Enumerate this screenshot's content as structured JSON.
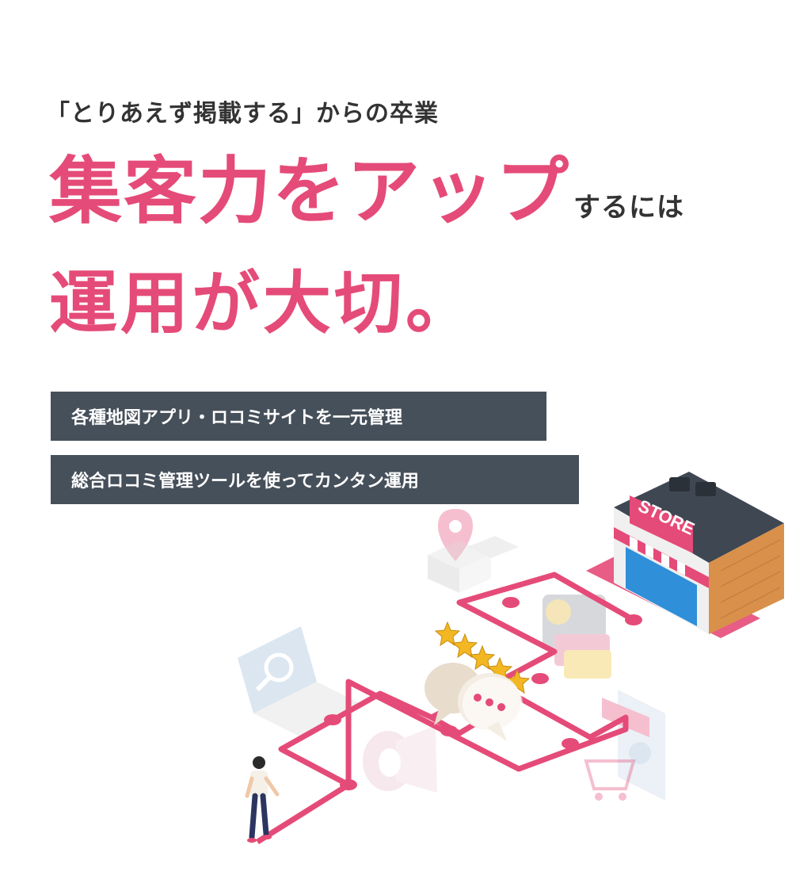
{
  "subtitle": "「とりあえず掲載する」からの卒業",
  "headline": {
    "line1_main": "集客力をアップ",
    "line1_suffix": "するには",
    "line2": "運用が大切。"
  },
  "features": [
    "各種地図アプリ・ロコミサイトを一元管理",
    "総合ロコミ管理ツールを使ってカンタン運用"
  ],
  "illustration": {
    "store_sign": "STORE",
    "rating_stars": 5,
    "colors": {
      "accent": "#e54b78",
      "dark_panel": "#46505a",
      "text_dark": "#333333",
      "star": "#f2b722",
      "roof": "#3f4752",
      "brick": "#d9904a",
      "glass": "#2f8fd8"
    }
  }
}
